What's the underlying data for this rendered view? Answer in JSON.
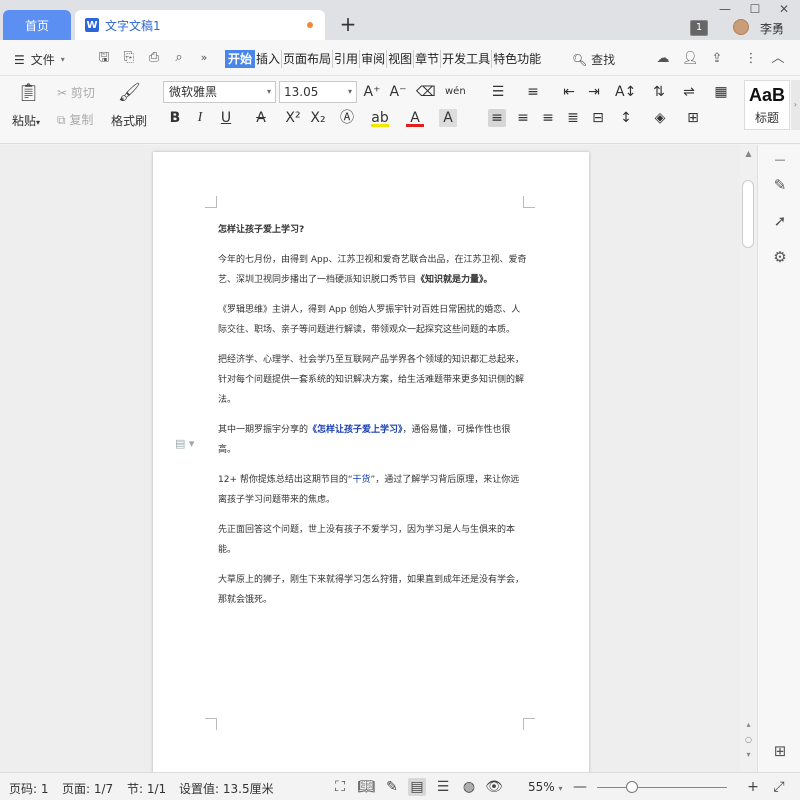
{
  "titlebar": {
    "home_tab": "首页",
    "doc_tab": "文字文稿1",
    "doc_icon_letter": "W",
    "add_tab": "+",
    "window_count": "1",
    "user_name": "李勇",
    "minimize": "—",
    "maximize": "☐",
    "close": "✕"
  },
  "menubar": {
    "file_label": "文件",
    "tabs": [
      "开始",
      "插入",
      "页面布局",
      "引用",
      "审阅",
      "视图",
      "章节",
      "开发工具",
      "特色功能"
    ],
    "search_label": "查找"
  },
  "ribbon": {
    "paste": "粘贴",
    "cut": "剪切",
    "copy": "复制",
    "format_painter": "格式刷",
    "font_name": "微软雅黑",
    "font_size": "13.05",
    "style_preview": "AaB",
    "style_label": "标题"
  },
  "document": {
    "paragraphs": [
      "怎样让孩子爱上学习?",
      "今年的七月份，由得到 App、江苏卫视和爱奇艺联合出品，在江苏卫视、爱奇艺、深圳卫视同步播出了一档硬派知识脱口秀节目",
      "《知识就是力量》。",
      "《罗辑思维》主讲人，得到 App 创始人罗振宇针对百姓日常困扰的婚恋、人际交往、职场、亲子等问题进行解读，带领观众一起探究这些问题的本质。",
      "把经济学、心理学、社会学乃至互联网产品学界各个领域的知识都汇总起来，针对每个问题提供一套系统的知识解决方案，给生活难题带来更多知识侧的解法。",
      "其中一期罗振宇分享的",
      "《怎样让孩子爱上学习》",
      "，通俗易懂，可操作性也很高。",
      "12+ 帮你提炼总结出这期节目的“",
      "干货",
      "”，通过了解学习背后原理，来让你远离孩子学习问题带来的焦虑。",
      "先正面回答这个问题，世上没有孩子不爱学习，因为学习是人与生俱来的本能。",
      "大草原上的狮子，刚生下来就得学习怎么狩猎，如果直到成年还是没有学会，那就会饿死。"
    ]
  },
  "statusbar": {
    "page_num": "页码: 1",
    "page_count": "页面: 1/7",
    "section": "节: 1/1",
    "setting": "设置值: 13.5厘米",
    "zoom": "55%",
    "zoom_level": 0.22
  },
  "colors": {
    "accent": "#4a86e8",
    "home_tab": "#5b8ff2",
    "link_blue": "#1a3fb0"
  }
}
